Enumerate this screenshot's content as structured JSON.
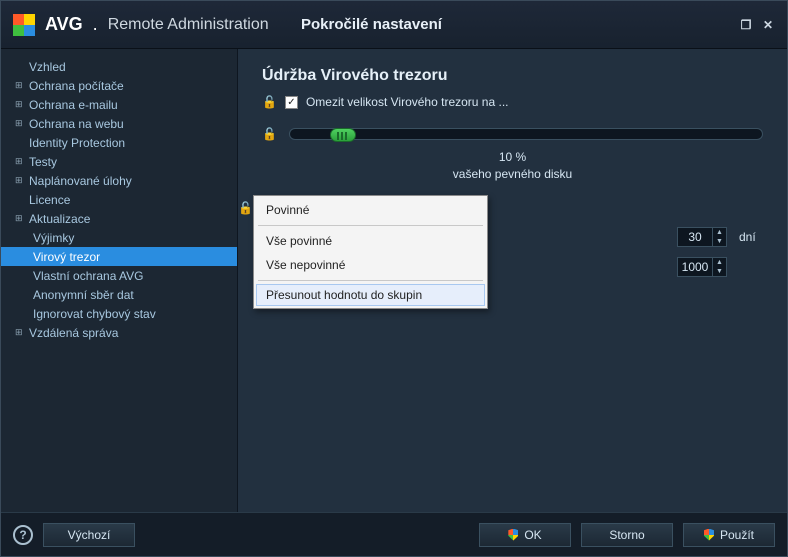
{
  "brand": {
    "avg": "AVG",
    "product": "Remote Administration",
    "dot": "."
  },
  "page_title": "Pokročilé nastavení",
  "win_controls": {
    "restore": "❐",
    "close": "✕"
  },
  "sidebar": {
    "items": [
      {
        "label": "Vzhled",
        "expandable": false,
        "child": false
      },
      {
        "label": "Ochrana počítače",
        "expandable": true,
        "child": false
      },
      {
        "label": "Ochrana e-mailu",
        "expandable": true,
        "child": false
      },
      {
        "label": "Ochrana na webu",
        "expandable": true,
        "child": false
      },
      {
        "label": "Identity Protection",
        "expandable": false,
        "child": false
      },
      {
        "label": "Testy",
        "expandable": true,
        "child": false
      },
      {
        "label": "Naplánované úlohy",
        "expandable": true,
        "child": false
      },
      {
        "label": "Licence",
        "expandable": false,
        "child": false
      },
      {
        "label": "Aktualizace",
        "expandable": true,
        "child": false
      },
      {
        "label": "Výjimky",
        "expandable": false,
        "child": true
      },
      {
        "label": "Virový trezor",
        "expandable": false,
        "child": true,
        "selected": true
      },
      {
        "label": "Vlastní ochrana AVG",
        "expandable": false,
        "child": true
      },
      {
        "label": "Anonymní sběr dat",
        "expandable": false,
        "child": true
      },
      {
        "label": "Ignorovat chybový stav",
        "expandable": false,
        "child": true
      },
      {
        "label": "Vzdálená správa",
        "expandable": true,
        "child": false
      }
    ],
    "expand_glyph": "⊞"
  },
  "main": {
    "title": "Údržba Virového trezoru",
    "limit_checkbox": {
      "checked": true,
      "label": "Omezit velikost Virového trezoru na ..."
    },
    "slider": {
      "percent_line": "10 %",
      "caption_line": "vašeho pevného disku"
    },
    "spinners": {
      "days": {
        "value": "30",
        "unit": "dní"
      },
      "count": {
        "value": "1000",
        "unit": ""
      }
    },
    "checkmark": "✓"
  },
  "context_menu": {
    "items": [
      {
        "label": "Povinné"
      },
      {
        "label": "Vše povinné"
      },
      {
        "label": "Vše nepovinné"
      }
    ],
    "action": {
      "label": "Přesunout hodnotu do skupin"
    }
  },
  "footer": {
    "default": "Výchozí",
    "ok": "OK",
    "cancel": "Storno",
    "apply": "Použít"
  },
  "icons": {
    "lock_open": "🔓",
    "help": "?"
  }
}
